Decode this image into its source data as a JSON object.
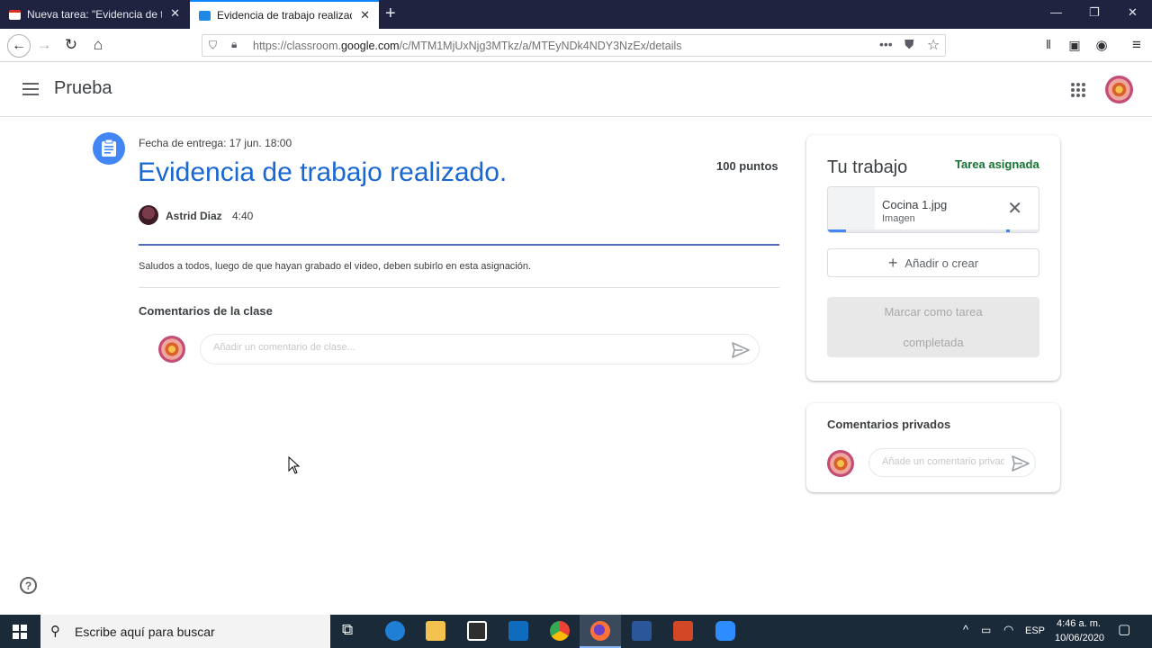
{
  "browser": {
    "tabs": [
      {
        "title": "Nueva tarea: \"Evidencia de trab",
        "active": false
      },
      {
        "title": "Evidencia de trabajo realizado.",
        "active": true
      }
    ],
    "url_prefix": "https://classroom.",
    "url_domain": "google.com",
    "url_path": "/c/MTM1MjUxNjg3MTkz/a/MTEyNDk4NDY3NzEx/details"
  },
  "app": {
    "name": "Prueba"
  },
  "assignment": {
    "due": "Fecha de entrega: 17 jun. 18:00",
    "title": "Evidencia de trabajo realizado.",
    "points": "100 puntos",
    "author": "Astrid Diaz",
    "time": "4:40",
    "description": "Saludos a todos, luego de que hayan grabado el video, deben subirlo en esta asignación."
  },
  "class_comments": {
    "title": "Comentarios de la clase",
    "placeholder": "Añadir un comentario de clase..."
  },
  "your_work": {
    "title": "Tu trabajo",
    "status": "Tarea asignada",
    "file_name": "Cocina 1.jpg",
    "file_type": "Imagen",
    "add_label": "Añadir o crear",
    "mark_label": "Marcar como tarea completada"
  },
  "private_comments": {
    "title": "Comentarios privados",
    "placeholder": "Añade un comentario privado..."
  },
  "taskbar": {
    "search_placeholder": "Escribe aquí para buscar",
    "lang": "ESP",
    "time": "4:46 a. m.",
    "date": "10/06/2020"
  },
  "colors": {
    "accent_blue": "#1967d2",
    "status_green": "#137333",
    "chrome_dark": "#202340"
  }
}
